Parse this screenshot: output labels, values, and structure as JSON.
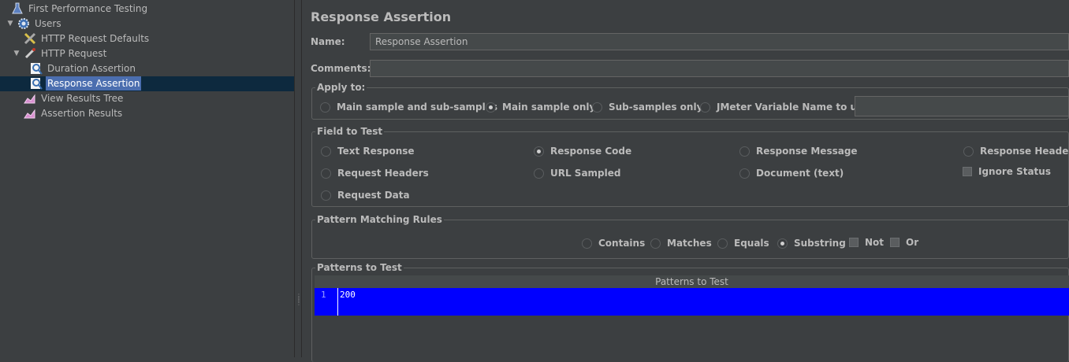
{
  "tree": {
    "items": [
      {
        "label": "First Performance Testing",
        "icon": "flask-icon"
      },
      {
        "label": "Users",
        "icon": "gear-icon"
      },
      {
        "label": "HTTP Request Defaults",
        "icon": "wrench-icon"
      },
      {
        "label": "HTTP Request",
        "icon": "pipette-icon"
      },
      {
        "label": "Duration Assertion",
        "icon": "magnifier-icon"
      },
      {
        "label": "Response Assertion",
        "icon": "magnifier-icon"
      },
      {
        "label": "View Results Tree",
        "icon": "chart-icon"
      },
      {
        "label": "Assertion Results",
        "icon": "chart-icon"
      }
    ],
    "selected_index": 5
  },
  "editor": {
    "title": "Response Assertion",
    "name_label": "Name:",
    "name_value": "Response Assertion",
    "comments_label": "Comments:",
    "comments_value": "",
    "apply_to": {
      "title": "Apply to:",
      "options": [
        "Main sample and sub-samples",
        "Main sample only",
        "Sub-samples only",
        "JMeter Variable Name to use"
      ],
      "selected": "Main sample only",
      "variable_value": ""
    },
    "field_to_test": {
      "title": "Field to Test",
      "options": [
        "Text Response",
        "Response Code",
        "Response Message",
        "Response Headers",
        "Request Headers",
        "URL Sampled",
        "Document (text)",
        "Request Data"
      ],
      "selected": "Response Code",
      "ignore_status_label": "Ignore Status",
      "ignore_status_checked": false
    },
    "pattern_matching": {
      "title": "Pattern Matching Rules",
      "options": [
        "Contains",
        "Matches",
        "Equals",
        "Substring"
      ],
      "selected": "Substring",
      "not_label": "Not",
      "not_checked": false,
      "or_label": "Or",
      "or_checked": false
    },
    "patterns": {
      "title": "Patterns to Test",
      "column_header": "Patterns to Test",
      "rows": [
        {
          "line": "1",
          "value": "200"
        }
      ]
    }
  },
  "colors": {
    "background": "#3c3f41",
    "selection": "#4b6eaf",
    "pattern_row": "#0000ff"
  }
}
